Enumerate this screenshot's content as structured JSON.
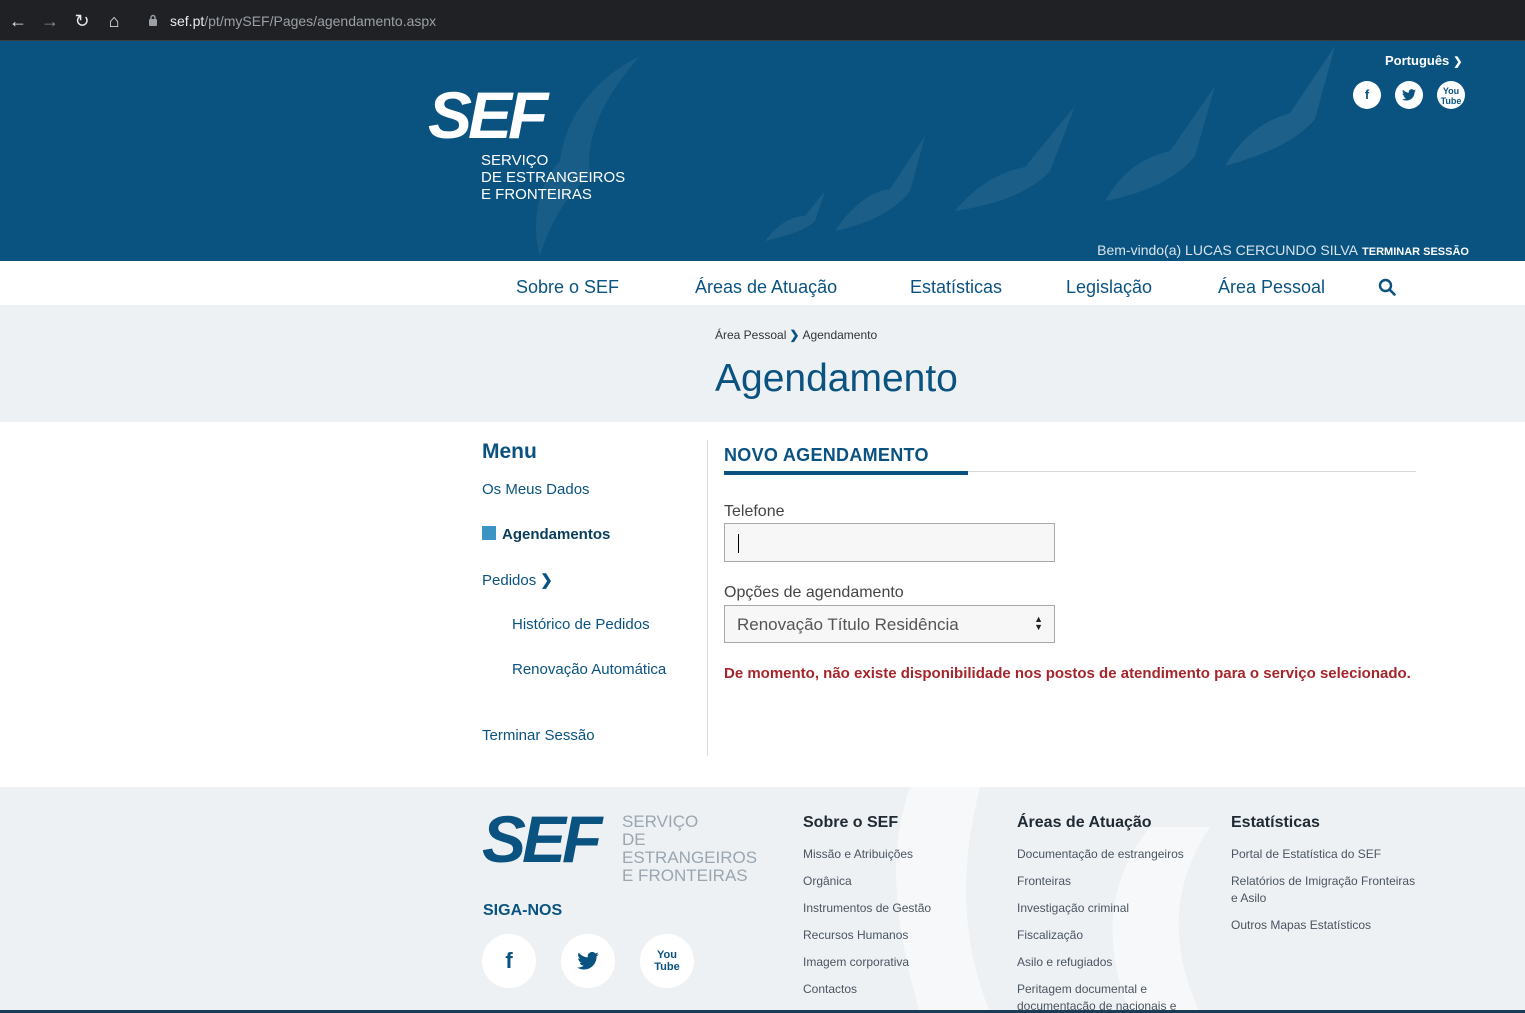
{
  "browser": {
    "url_host": "sef.pt",
    "url_path": "/pt/mySEF/Pages/agendamento.aspx"
  },
  "header": {
    "logo_text": "SEF",
    "logo_subtitle_1": "SERVIÇO",
    "logo_subtitle_2": "DE ESTRANGEIROS",
    "logo_subtitle_3": "E FRONTEIRAS",
    "language": "Português",
    "welcome": "Bem-vindo(a) LUCAS CERCUNDO SILVA",
    "logout": "TERMINAR SESSÃO",
    "social": [
      "f",
      "t",
      "yt"
    ]
  },
  "nav": {
    "items": [
      "Sobre o SEF",
      "Áreas de Atuação",
      "Estatísticas",
      "Legislação",
      "Área Pessoal"
    ]
  },
  "breadcrumb": {
    "parent": "Área Pessoal",
    "current": "Agendamento"
  },
  "page": {
    "title": "Agendamento"
  },
  "menu": {
    "title": "Menu",
    "items": {
      "meus_dados": "Os Meus Dados",
      "agendamentos": "Agendamentos",
      "pedidos": "Pedidos",
      "historico": "Histórico de Pedidos",
      "renovacao": "Renovação Automática",
      "terminar": "Terminar Sessão"
    }
  },
  "form": {
    "tab_title": "NOVO AGENDAMENTO",
    "telefone_label": "Telefone",
    "telefone_value": "",
    "opcoes_label": "Opções de agendamento",
    "opcoes_selected": "Renovação Título Residência",
    "error": "De momento, não existe disponibilidade nos postos de atendimento para o serviço selecionado."
  },
  "footer": {
    "logo_text": "SEF",
    "logo_subtitle_1": "SERVIÇO",
    "logo_subtitle_2": "DE ESTRANGEIROS",
    "logo_subtitle_3": "E FRONTEIRAS",
    "follow": "SIGA-NOS",
    "col1": {
      "title": "Sobre o SEF",
      "items": [
        "Missão e Atribuições",
        "Orgânica",
        "Instrumentos de Gestão",
        "Recursos Humanos",
        "Imagem corporativa",
        "Contactos"
      ]
    },
    "col2": {
      "title": "Áreas de Atuação",
      "items": [
        "Documentação de estrangeiros",
        "Fronteiras",
        "Investigação criminal",
        "Fiscalização",
        "Asilo e refugiados",
        "Peritagem documental e documentação de nacionais e"
      ]
    },
    "col3": {
      "title": "Estatísticas",
      "items": [
        "Portal de Estatística do SEF",
        "Relatórios de Imigração Fronteiras e Asilo",
        "Outros Mapas Estatísticos"
      ]
    }
  },
  "colors": {
    "brand": "#0a5381",
    "active_square": "#3a94c4",
    "error": "#a4262c"
  }
}
